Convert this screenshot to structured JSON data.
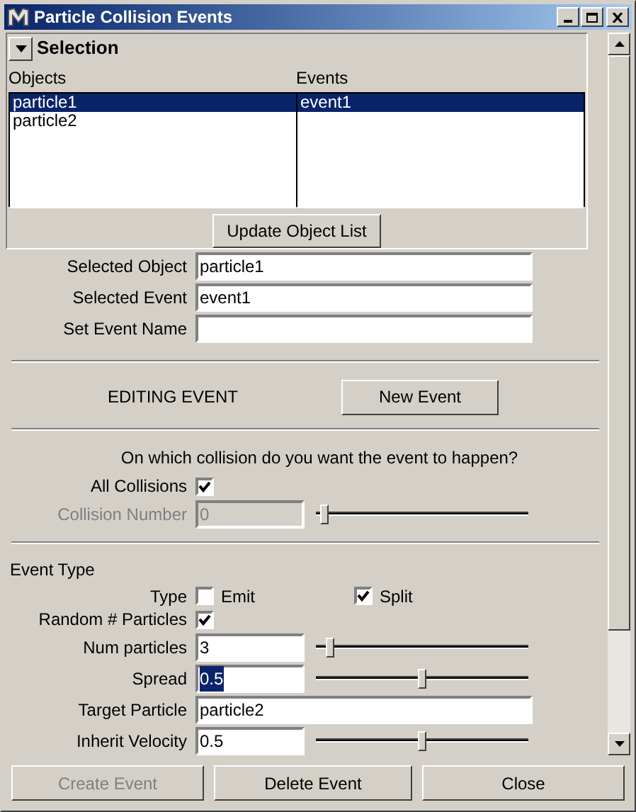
{
  "window": {
    "title": "Particle Collision Events"
  },
  "selection": {
    "title": "Selection",
    "expanded": true,
    "objects": {
      "label": "Objects",
      "items": [
        {
          "label": "particle1",
          "selected": true
        },
        {
          "label": "particle2",
          "selected": false
        }
      ]
    },
    "events": {
      "label": "Events",
      "items": [
        {
          "label": "event1",
          "selected": true
        }
      ]
    },
    "update_button": "Update Object List"
  },
  "fields": [
    {
      "label": "Selected Object",
      "value": "particle1"
    },
    {
      "label": "Selected Event",
      "value": "event1"
    },
    {
      "label": "Set Event Name"
    }
  ],
  "editing": {
    "label": "EDITING EVENT",
    "button": "New Event"
  },
  "collision": {
    "question": "On which collision do you want the event to happen?",
    "all_collisions": {
      "label": "All Collisions",
      "checked": true
    },
    "collision_number": {
      "label": "Collision Number",
      "value": "0",
      "disabled": true,
      "level": 0.02
    }
  },
  "event_type": {
    "title": "Event Type",
    "type_label": "Type",
    "types": [
      {
        "label": "Emit",
        "checked": false
      },
      {
        "label": "Split",
        "checked": true
      }
    ],
    "rows": [
      {
        "kind": "checkbox",
        "label": "Random # Particles",
        "checked": true
      },
      {
        "kind": "slider",
        "label": "Num particles",
        "value": "3",
        "level": 0.05,
        "text_selected": false
      },
      {
        "kind": "slider",
        "label": "Spread",
        "value": "0.5",
        "level": 0.5,
        "text_selected": true
      },
      {
        "kind": "text",
        "label": "Target Particle",
        "value": "particle2"
      },
      {
        "kind": "slider",
        "label": "Inherit Velocity",
        "value": "0.5",
        "level": 0.5,
        "text_selected": false
      }
    ]
  },
  "buttons": [
    {
      "label": "Create Event",
      "disabled": true
    },
    {
      "label": "Delete Event",
      "disabled": false
    },
    {
      "label": "Close",
      "disabled": false
    }
  ]
}
